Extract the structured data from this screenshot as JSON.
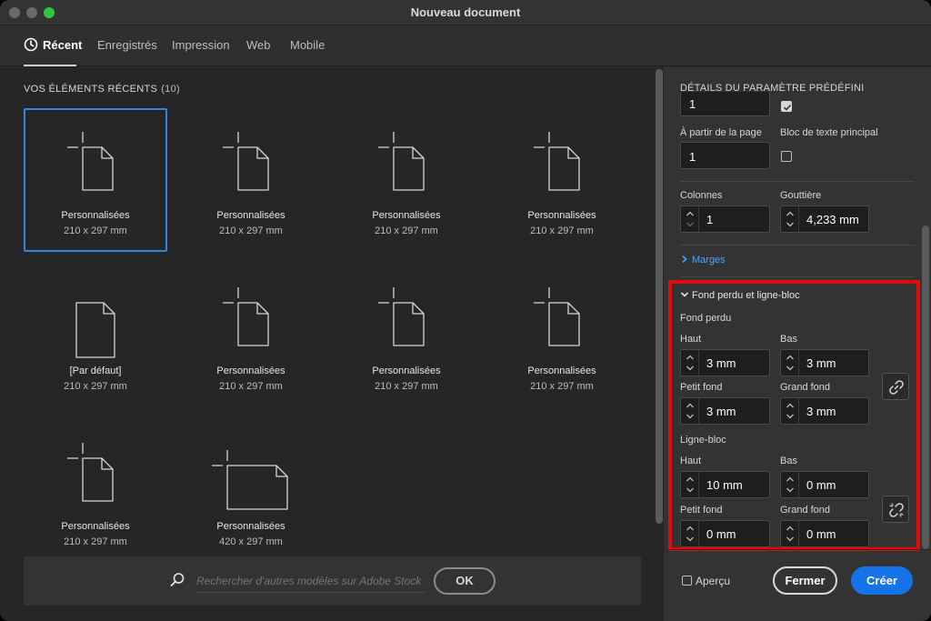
{
  "window": {
    "title": "Nouveau document"
  },
  "tabs": [
    {
      "label": "Récent",
      "active": true
    },
    {
      "label": "Enregistrés"
    },
    {
      "label": "Impression"
    },
    {
      "label": "Web"
    },
    {
      "label": "Mobile"
    }
  ],
  "recent": {
    "title": "VOS ÉLÉMENTS RÉCENTS",
    "count": "(10)",
    "items": [
      {
        "name": "Personnalisées",
        "size": "210 x 297 mm",
        "icon": "page-with-crop-icon",
        "selected": true
      },
      {
        "name": "Personnalisées",
        "size": "210 x 297 mm",
        "icon": "page-with-crop-icon"
      },
      {
        "name": "Personnalisées",
        "size": "210 x 297 mm",
        "icon": "page-with-crop-icon"
      },
      {
        "name": "Personnalisées",
        "size": "210 x 297 mm",
        "icon": "page-with-crop-icon"
      },
      {
        "name": "[Par défaut]",
        "size": "210 x 297 mm",
        "icon": "page-icon"
      },
      {
        "name": "Personnalisées",
        "size": "210 x 297 mm",
        "icon": "page-with-crop-icon"
      },
      {
        "name": "Personnalisées",
        "size": "210 x 297 mm",
        "icon": "page-with-crop-icon"
      },
      {
        "name": "Personnalisées",
        "size": "210 x 297 mm",
        "icon": "page-with-crop-icon"
      },
      {
        "name": "Personnalisées",
        "size": "210 x 297 mm",
        "icon": "page-with-crop-icon"
      },
      {
        "name": "Personnalisées",
        "size": "420 x 297 mm",
        "icon": "landscape-page-with-crop-icon"
      }
    ]
  },
  "search": {
    "placeholder": "Rechercher d'autres modèles sur Adobe Stock",
    "ok_label": "OK"
  },
  "preset": {
    "title": "DÉTAILS DU PARAMÈTRE PRÉDÉFINI",
    "pages_value": "1",
    "facing_pages_checked": true,
    "start_page_label": "À partir de la page",
    "start_page_value": "1",
    "primary_text_frame_label": "Bloc de texte principal",
    "columns_label": "Colonnes",
    "columns_value": "1",
    "gutter_label": "Gouttière",
    "gutter_value": "4,233 mm",
    "margins_label": "Marges",
    "bleed_section_label": "Fond perdu et ligne-bloc",
    "bleed": {
      "label": "Fond perdu",
      "top_label": "Haut",
      "top": "3 mm",
      "bottom_label": "Bas",
      "bottom": "3 mm",
      "inside_label": "Petit fond",
      "inside": "3 mm",
      "outside_label": "Grand fond",
      "outside": "3 mm"
    },
    "slug": {
      "label": "Ligne-bloc",
      "top_label": "Haut",
      "top": "10 mm",
      "bottom_label": "Bas",
      "bottom": "0 mm",
      "inside_label": "Petit fond",
      "inside": "0 mm",
      "outside_label": "Grand fond",
      "outside": "0 mm"
    }
  },
  "footer": {
    "preview_label": "Aperçu",
    "close_label": "Fermer",
    "create_label": "Créer"
  },
  "colors": {
    "accent": "#1473e6",
    "selection": "#2f86e0",
    "highlight": "#e00c0c",
    "link": "#4aa3ff"
  }
}
